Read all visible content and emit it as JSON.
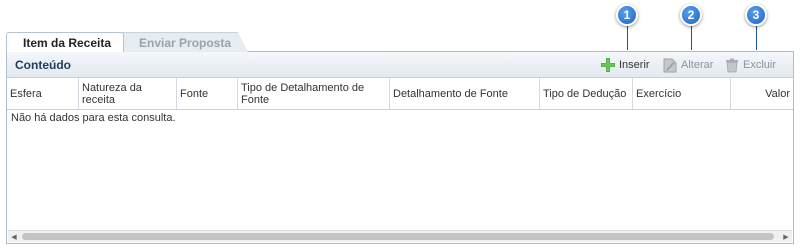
{
  "tabs": [
    {
      "label": "Item da Receita",
      "active": true
    },
    {
      "label": "Enviar Proposta",
      "active": false
    }
  ],
  "panel": {
    "title": "Conteúdo",
    "toolbar": {
      "insert_label": "Inserir",
      "alter_label": "Alterar",
      "delete_label": "Excluir"
    }
  },
  "markers": [
    "1",
    "2",
    "3"
  ],
  "table": {
    "columns": [
      "Esfera",
      "Natureza da receita",
      "Fonte",
      "Tipo de Detalhamento de Fonte",
      "Detalhamento de Fonte",
      "Tipo de Dedução",
      "Exercício",
      "Valor"
    ],
    "empty_message": "Não há dados para esta consulta."
  },
  "icons": {
    "insert": "plus-icon",
    "alter": "edit-icon",
    "delete": "trash-icon"
  },
  "colors": {
    "marker": "#2a73d6",
    "insert_icon": "#3fa535",
    "panel_title": "#1f3d63"
  }
}
